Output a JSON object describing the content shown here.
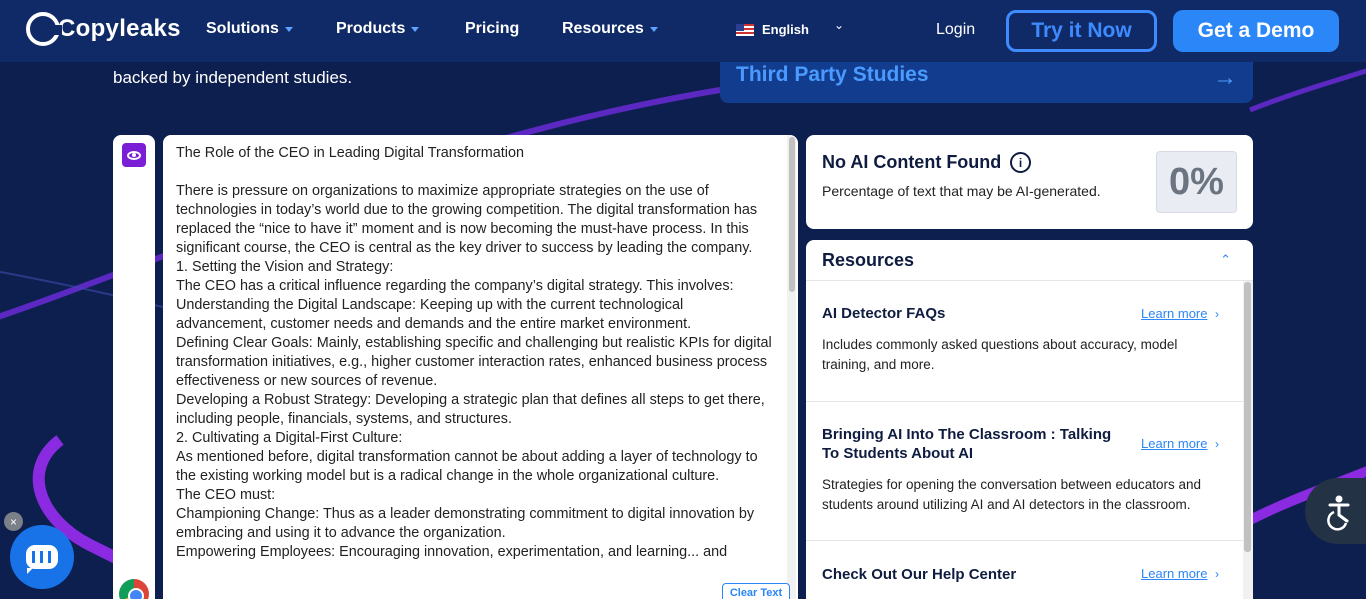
{
  "nav": {
    "logo_text": "Copyleaks",
    "items": [
      {
        "label": "Solutions",
        "dropdown": true
      },
      {
        "label": "Products",
        "dropdown": true
      },
      {
        "label": "Pricing",
        "dropdown": false
      },
      {
        "label": "Resources",
        "dropdown": true
      }
    ],
    "language": "English",
    "login": "Login",
    "try_button": "Try it Now",
    "demo_button": "Get a Demo"
  },
  "intro": {
    "line": "backed by independent studies.",
    "studies_link": "Third Party Studies"
  },
  "editor": {
    "text": "The Role of the CEO in Leading Digital Transformation\n\nThere is pressure on organizations to maximize appropriate strategies on the use of technologies in today’s world due to the growing competition. The digital transformation has replaced the “nice to have it” moment and is now becoming the must-have process. In this significant course, the CEO is central as the key driver to success by leading the company.\n1. Setting the Vision and Strategy:\nThe CEO has a critical influence regarding the company’s digital strategy. This involves:\nUnderstanding the Digital Landscape: Keeping up with the current technological advancement, customer needs and demands and the entire market environment.\nDefining Clear Goals: Mainly, establishing specific and challenging but realistic KPIs for digital transformation initiatives, e.g., higher customer interaction rates, enhanced business process effectiveness or new sources of revenue.\nDeveloping a Robust Strategy: Developing a strategic plan that defines all steps to get there, including people, financials, systems, and structures.\n2. Cultivating a Digital-First Culture:\nAs mentioned before, digital transformation cannot be about adding a layer of technology to the existing working model but is a radical change in the whole organizational culture.\nThe CEO must:\nChampioning Change: Thus as a leader demonstrating commitment to digital innovation by embracing and using it to advance the organization.\nEmpowering Employees: Encouraging innovation, experimentation, and learning... and",
    "clear_button": "Clear Text"
  },
  "result": {
    "title": "No AI Content Found",
    "subtitle": "Percentage of text that may be AI-generated.",
    "percentage": "0%"
  },
  "resources": {
    "title": "Resources",
    "learn_more": "Learn more",
    "items": [
      {
        "title": "AI Detector FAQs",
        "description": "Includes commonly asked questions about accuracy, model training, and more."
      },
      {
        "title": "Bringing AI Into The Classroom : Talking To Students About AI",
        "description": "Strategies for opening the conversation between educators and students around utilizing AI and AI detectors in the classroom."
      },
      {
        "title": "Check Out Our Help Center",
        "description": ""
      }
    ]
  },
  "colors": {
    "background": "#0d1f4f",
    "nav": "#0f2a66",
    "accent": "#2b86f8",
    "eye_icon": "#7b1fd6"
  },
  "icons": [
    "eye-icon",
    "info-icon",
    "arrow-right-icon",
    "chevron-up-icon",
    "chevron-right-icon",
    "chat-icon",
    "close-icon",
    "accessibility-icon",
    "chrome-icon",
    "flag-us-icon"
  ]
}
